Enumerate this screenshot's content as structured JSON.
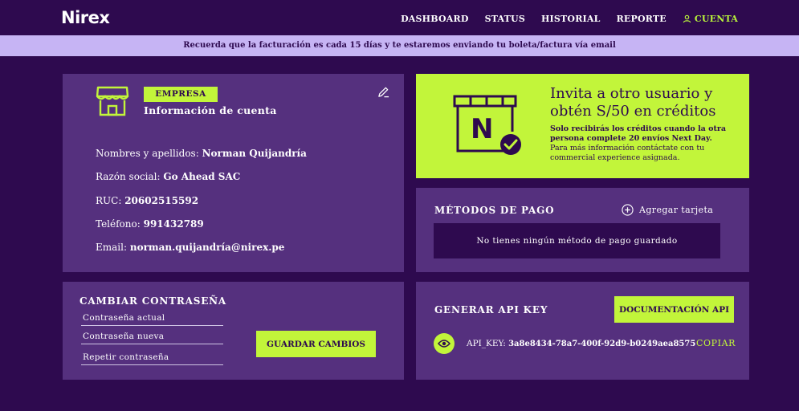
{
  "header": {
    "logo": "Nirex",
    "nav": [
      {
        "label": "DASHBOARD"
      },
      {
        "label": "STATUS"
      },
      {
        "label": "HISTORIAL"
      },
      {
        "label": "REPORTE"
      }
    ],
    "account_label": "CUENTA"
  },
  "banner": {
    "text": "Recuerda que la facturación es cada 15 días y te estaremos enviando tu boleta/factura vía email"
  },
  "account": {
    "badge": "EMPRESA",
    "title": "Información de cuenta",
    "fields": [
      {
        "label": "Nombres y apellidos:",
        "value": "Norman Quijandría"
      },
      {
        "label": "Razón social:",
        "value": "Go Ahead SAC"
      },
      {
        "label": "RUC:",
        "value": "20602515592"
      },
      {
        "label": "Teléfono:",
        "value": "991432789"
      },
      {
        "label": "Email:",
        "value": "norman.quijandría@nirex.pe"
      }
    ]
  },
  "invite": {
    "title": "Invita a otro usuario y obtén S/50 en créditos",
    "bold_note": "Solo recibirás los créditos cuando la otra persona complete 20 envíos Next Day.",
    "note": "Para más información contáctate con tu commercial experience asignada.",
    "icon_letter": "N"
  },
  "payment": {
    "title": "MÉTODOS DE PAGO",
    "add_label": "Agregar tarjeta",
    "empty_text": "No tienes ningún método de pago guardado"
  },
  "password": {
    "title": "CAMBIAR CONTRASEÑA",
    "current_placeholder": "Contraseña actual",
    "new_placeholder": "Contraseña nueva",
    "repeat_placeholder": "Repetir contraseña",
    "save_label": "GUARDAR CAMBIOS"
  },
  "api": {
    "title": "GENERAR API KEY",
    "docs_label": "DOCUMENTACIÓN API",
    "key_label": "API_KEY:",
    "key_value": "3a8e8434-78a7-400f-92d9-b0249aea8575",
    "copy_label": "COPIAR"
  },
  "colors": {
    "background": "#2e0a4f",
    "card": "#55307e",
    "accent": "#c2f53a",
    "banner": "#c6b4f4"
  }
}
